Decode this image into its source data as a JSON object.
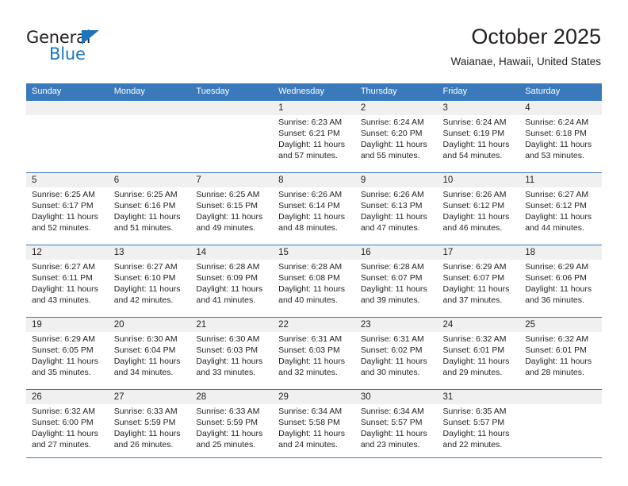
{
  "branding": {
    "logo_text_primary": "General",
    "logo_text_secondary": "Blue",
    "logo_triangle_icon": "triangle-icon",
    "accent_color": "#3a79bc",
    "logo_blue": "#1b75bb"
  },
  "header": {
    "title": "October 2025",
    "subtitle": "Waianae, Hawaii, United States"
  },
  "calendar": {
    "weekday_headers": [
      "Sunday",
      "Monday",
      "Tuesday",
      "Wednesday",
      "Thursday",
      "Friday",
      "Saturday"
    ],
    "weeks": [
      [
        {
          "day": "",
          "lines": []
        },
        {
          "day": "",
          "lines": []
        },
        {
          "day": "",
          "lines": []
        },
        {
          "day": "1",
          "lines": [
            "Sunrise: 6:23 AM",
            "Sunset: 6:21 PM",
            "Daylight: 11 hours",
            "and 57 minutes."
          ]
        },
        {
          "day": "2",
          "lines": [
            "Sunrise: 6:24 AM",
            "Sunset: 6:20 PM",
            "Daylight: 11 hours",
            "and 55 minutes."
          ]
        },
        {
          "day": "3",
          "lines": [
            "Sunrise: 6:24 AM",
            "Sunset: 6:19 PM",
            "Daylight: 11 hours",
            "and 54 minutes."
          ]
        },
        {
          "day": "4",
          "lines": [
            "Sunrise: 6:24 AM",
            "Sunset: 6:18 PM",
            "Daylight: 11 hours",
            "and 53 minutes."
          ]
        }
      ],
      [
        {
          "day": "5",
          "lines": [
            "Sunrise: 6:25 AM",
            "Sunset: 6:17 PM",
            "Daylight: 11 hours",
            "and 52 minutes."
          ]
        },
        {
          "day": "6",
          "lines": [
            "Sunrise: 6:25 AM",
            "Sunset: 6:16 PM",
            "Daylight: 11 hours",
            "and 51 minutes."
          ]
        },
        {
          "day": "7",
          "lines": [
            "Sunrise: 6:25 AM",
            "Sunset: 6:15 PM",
            "Daylight: 11 hours",
            "and 49 minutes."
          ]
        },
        {
          "day": "8",
          "lines": [
            "Sunrise: 6:26 AM",
            "Sunset: 6:14 PM",
            "Daylight: 11 hours",
            "and 48 minutes."
          ]
        },
        {
          "day": "9",
          "lines": [
            "Sunrise: 6:26 AM",
            "Sunset: 6:13 PM",
            "Daylight: 11 hours",
            "and 47 minutes."
          ]
        },
        {
          "day": "10",
          "lines": [
            "Sunrise: 6:26 AM",
            "Sunset: 6:12 PM",
            "Daylight: 11 hours",
            "and 46 minutes."
          ]
        },
        {
          "day": "11",
          "lines": [
            "Sunrise: 6:27 AM",
            "Sunset: 6:12 PM",
            "Daylight: 11 hours",
            "and 44 minutes."
          ]
        }
      ],
      [
        {
          "day": "12",
          "lines": [
            "Sunrise: 6:27 AM",
            "Sunset: 6:11 PM",
            "Daylight: 11 hours",
            "and 43 minutes."
          ]
        },
        {
          "day": "13",
          "lines": [
            "Sunrise: 6:27 AM",
            "Sunset: 6:10 PM",
            "Daylight: 11 hours",
            "and 42 minutes."
          ]
        },
        {
          "day": "14",
          "lines": [
            "Sunrise: 6:28 AM",
            "Sunset: 6:09 PM",
            "Daylight: 11 hours",
            "and 41 minutes."
          ]
        },
        {
          "day": "15",
          "lines": [
            "Sunrise: 6:28 AM",
            "Sunset: 6:08 PM",
            "Daylight: 11 hours",
            "and 40 minutes."
          ]
        },
        {
          "day": "16",
          "lines": [
            "Sunrise: 6:28 AM",
            "Sunset: 6:07 PM",
            "Daylight: 11 hours",
            "and 39 minutes."
          ]
        },
        {
          "day": "17",
          "lines": [
            "Sunrise: 6:29 AM",
            "Sunset: 6:07 PM",
            "Daylight: 11 hours",
            "and 37 minutes."
          ]
        },
        {
          "day": "18",
          "lines": [
            "Sunrise: 6:29 AM",
            "Sunset: 6:06 PM",
            "Daylight: 11 hours",
            "and 36 minutes."
          ]
        }
      ],
      [
        {
          "day": "19",
          "lines": [
            "Sunrise: 6:29 AM",
            "Sunset: 6:05 PM",
            "Daylight: 11 hours",
            "and 35 minutes."
          ]
        },
        {
          "day": "20",
          "lines": [
            "Sunrise: 6:30 AM",
            "Sunset: 6:04 PM",
            "Daylight: 11 hours",
            "and 34 minutes."
          ]
        },
        {
          "day": "21",
          "lines": [
            "Sunrise: 6:30 AM",
            "Sunset: 6:03 PM",
            "Daylight: 11 hours",
            "and 33 minutes."
          ]
        },
        {
          "day": "22",
          "lines": [
            "Sunrise: 6:31 AM",
            "Sunset: 6:03 PM",
            "Daylight: 11 hours",
            "and 32 minutes."
          ]
        },
        {
          "day": "23",
          "lines": [
            "Sunrise: 6:31 AM",
            "Sunset: 6:02 PM",
            "Daylight: 11 hours",
            "and 30 minutes."
          ]
        },
        {
          "day": "24",
          "lines": [
            "Sunrise: 6:32 AM",
            "Sunset: 6:01 PM",
            "Daylight: 11 hours",
            "and 29 minutes."
          ]
        },
        {
          "day": "25",
          "lines": [
            "Sunrise: 6:32 AM",
            "Sunset: 6:01 PM",
            "Daylight: 11 hours",
            "and 28 minutes."
          ]
        }
      ],
      [
        {
          "day": "26",
          "lines": [
            "Sunrise: 6:32 AM",
            "Sunset: 6:00 PM",
            "Daylight: 11 hours",
            "and 27 minutes."
          ]
        },
        {
          "day": "27",
          "lines": [
            "Sunrise: 6:33 AM",
            "Sunset: 5:59 PM",
            "Daylight: 11 hours",
            "and 26 minutes."
          ]
        },
        {
          "day": "28",
          "lines": [
            "Sunrise: 6:33 AM",
            "Sunset: 5:59 PM",
            "Daylight: 11 hours",
            "and 25 minutes."
          ]
        },
        {
          "day": "29",
          "lines": [
            "Sunrise: 6:34 AM",
            "Sunset: 5:58 PM",
            "Daylight: 11 hours",
            "and 24 minutes."
          ]
        },
        {
          "day": "30",
          "lines": [
            "Sunrise: 6:34 AM",
            "Sunset: 5:57 PM",
            "Daylight: 11 hours",
            "and 23 minutes."
          ]
        },
        {
          "day": "31",
          "lines": [
            "Sunrise: 6:35 AM",
            "Sunset: 5:57 PM",
            "Daylight: 11 hours",
            "and 22 minutes."
          ]
        },
        {
          "day": "",
          "lines": []
        }
      ]
    ]
  }
}
